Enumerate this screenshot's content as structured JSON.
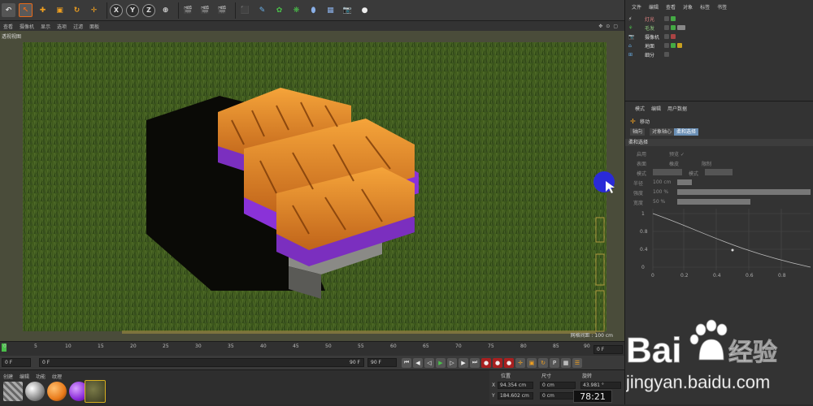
{
  "toolbar": {
    "axes": [
      "X",
      "Y",
      "Z"
    ]
  },
  "viewport_menu": {
    "items": [
      "查看",
      "摄像机",
      "显示",
      "选项",
      "过滤",
      "面板"
    ],
    "label": "透视视图",
    "grid_info": "网格间距 : 100 cm"
  },
  "timeline": {
    "ticks": [
      "0",
      "5",
      "10",
      "15",
      "20",
      "25",
      "30",
      "35",
      "40",
      "45",
      "50",
      "55",
      "60",
      "65",
      "70",
      "75",
      "80",
      "85",
      "90"
    ],
    "current_frame": "0 F"
  },
  "transport": {
    "start_field": "0 F",
    "range_start": "0 F",
    "range_end": "90 F",
    "end_field": "90 F"
  },
  "materials": {
    "menu": [
      "创建",
      "编辑",
      "功能",
      "纹理"
    ],
    "swatches": [
      "#9a9a9a",
      "#d7d7d7",
      "#e87a1a",
      "#8a2bd8",
      "#4a4a28"
    ]
  },
  "object_manager": {
    "menu": [
      "文件",
      "编辑",
      "查看",
      "对象",
      "标签",
      "书签"
    ],
    "objects": [
      {
        "name": "灯光"
      },
      {
        "name": "毛发"
      },
      {
        "name": "摄像机"
      },
      {
        "name": "地面"
      },
      {
        "name": "细分"
      }
    ]
  },
  "attribute_manager": {
    "menu": [
      "模式",
      "编辑",
      "用户数据"
    ],
    "mode": "移动",
    "tabs": [
      "轴向",
      "对象轴心",
      "柔和选择"
    ],
    "active_tab": "柔和选择",
    "section": "柔和选择",
    "fields": [
      {
        "label": "启用",
        "value": "预览 ✓"
      },
      {
        "label": "表面",
        "value": "橡皮"
      },
      {
        "label": "限制",
        "value": ""
      },
      {
        "label": "模式",
        "value": "线性"
      },
      {
        "label": "半径",
        "value": "100 cm"
      },
      {
        "label": "强度",
        "value": "100 %"
      },
      {
        "label": "宽度",
        "value": "50 %"
      }
    ],
    "graph": {
      "y_ticks": [
        "1",
        "0.8",
        "0.4",
        "0"
      ],
      "x_ticks": [
        "0",
        "0.2",
        "0.4",
        "0.6",
        "0.8"
      ]
    }
  },
  "coords": {
    "headers": [
      "位置",
      "尺寸",
      "旋转"
    ],
    "x_pos": "94.354 cm",
    "y_pos": "184.602 cm",
    "x_size": "0 cm",
    "y_size": "0 cm",
    "h_rot": "43.981 °"
  },
  "timecode": "78:21",
  "watermark": {
    "brand": "Bai",
    "brand2": "经验",
    "url": "jingyan.baidu.com"
  }
}
